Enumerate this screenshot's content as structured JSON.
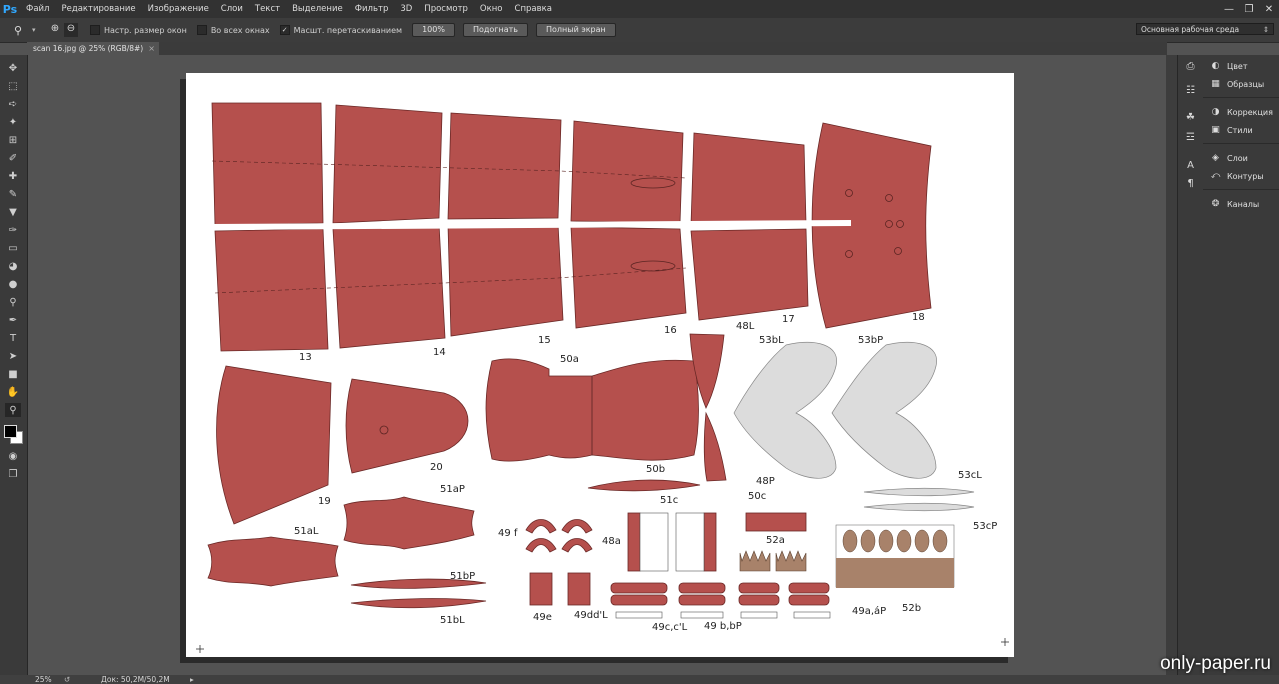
{
  "app": {
    "logo": "Ps"
  },
  "menu": [
    "Файл",
    "Редактирование",
    "Изображение",
    "Слои",
    "Текст",
    "Выделение",
    "Фильтр",
    "3D",
    "Просмотр",
    "Окно",
    "Справка"
  ],
  "window_controls": {
    "minimize_icon": "minimize-icon",
    "restore_icon": "restore-icon",
    "close_icon": "close-icon"
  },
  "options": {
    "resize_windows": {
      "label": "Настр. размер окон",
      "checked": false
    },
    "all_windows": {
      "label": "Во всех окнах",
      "checked": false
    },
    "scrubby_zoom": {
      "label": "Масшт. перетаскиванием",
      "checked": true
    },
    "btn_100": "100%",
    "btn_fit": "Подогнать",
    "btn_fullscreen": "Полный экран",
    "workspace": "Основная рабочая среда"
  },
  "document": {
    "tab_title": "scan 16.jpg @ 25% (RGB/8#)",
    "close": "×"
  },
  "panels": [
    {
      "label": "Цвет",
      "icon": "color-icon"
    },
    {
      "label": "Образцы",
      "icon": "swatches-icon"
    },
    {
      "label": "Коррекция",
      "icon": "adjustments-icon"
    },
    {
      "label": "Стили",
      "icon": "styles-icon"
    },
    {
      "label": "Слои",
      "icon": "layers-icon"
    },
    {
      "label": "Контуры",
      "icon": "paths-icon"
    },
    {
      "label": "Каналы",
      "icon": "channels-icon"
    }
  ],
  "status": {
    "zoom": "25%",
    "doc_size": "Док: 50,2M/50,2M"
  },
  "colors": {
    "part_red": "#b5504d",
    "part_grey": "#dcdcdc",
    "part_brown": "#a8826a",
    "bg": "#535353"
  },
  "parts": {
    "p13": "13",
    "p14": "14",
    "p15": "15",
    "p16": "16",
    "p17": "17",
    "p18": "18",
    "p19": "19",
    "p20": "20",
    "p50a": "50a",
    "p48L": "48L",
    "p48P": "48P",
    "p53bL": "53bL",
    "p53bP": "53bP",
    "p50b": "50b",
    "p53cL": "53cL",
    "p53cP": "53cP",
    "p51aP": "51aP",
    "p51aL": "51aL",
    "p51bP": "51bP",
    "p51bL": "51bL",
    "p49f": "49 f",
    "p48a": "48a",
    "p51c": "51c",
    "p50c": "50c",
    "p52a": "52a",
    "p49e": "49e",
    "p49ddL": "49dd'L",
    "p49ccL": "49c,c'L",
    "p49bbP": "49 b,bP",
    "p49aaP": "49a,áP",
    "p52b": "52b"
  },
  "watermark": "only-paper.ru"
}
